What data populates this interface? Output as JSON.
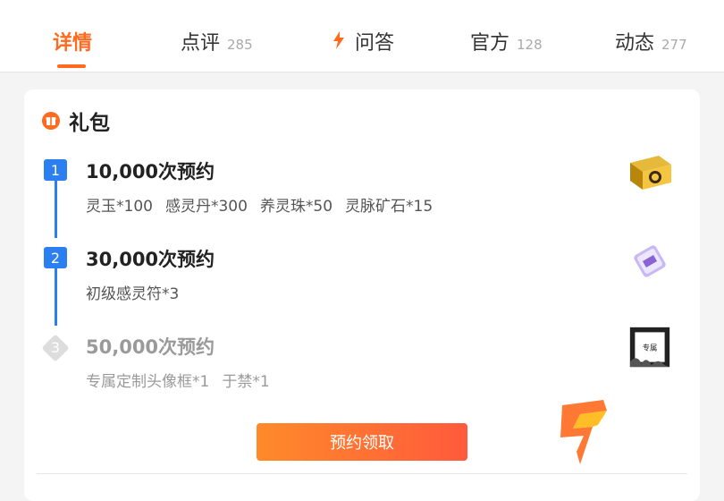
{
  "tabs": [
    {
      "label": "详情",
      "count": ""
    },
    {
      "label": "点评",
      "count": "285"
    },
    {
      "label": "问答",
      "count": ""
    },
    {
      "label": "官方",
      "count": "128"
    },
    {
      "label": "动态",
      "count": "277"
    }
  ],
  "active_tab": "详情",
  "section": {
    "title": "礼包"
  },
  "milestones": [
    {
      "step": "1",
      "title": "10,000次预约",
      "rewards": [
        "灵玉*100",
        "感灵丹*300",
        "养灵珠*50",
        "灵脉矿石*15"
      ],
      "unlocked": true,
      "reward_icon": "gold-chest-icon"
    },
    {
      "step": "2",
      "title": "30,000次预约",
      "rewards": [
        "初级感灵符*3"
      ],
      "unlocked": true,
      "reward_icon": "talisman-ticket-icon"
    },
    {
      "step": "3",
      "title": "50,000次预约",
      "rewards": [
        "专属定制头像框*1",
        "于禁*1"
      ],
      "unlocked": false,
      "reward_icon": "avatar-frame-icon",
      "reward_icon_text": "专属"
    }
  ],
  "claim_button": "预约领取",
  "colors": {
    "accent": "#ff6a1f",
    "timeline": "#2b7ff0",
    "locked": "#9a9a9a"
  }
}
